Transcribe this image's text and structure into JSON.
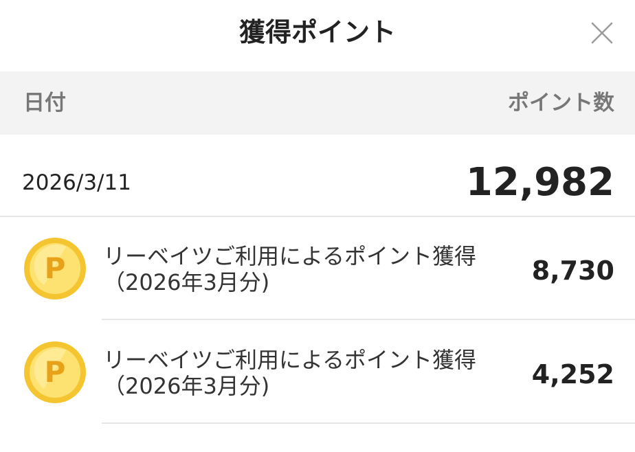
{
  "header": {
    "title": "獲得ポイント",
    "close_icon": "close-icon"
  },
  "columns": {
    "date": "日付",
    "points": "ポイント数"
  },
  "group": {
    "date": "2026/3/11",
    "total": "12,982"
  },
  "items": [
    {
      "icon": "point-coin-icon",
      "description": "リーベイツご利用によるポイント獲得（2026年3月分)",
      "points": "8,730"
    },
    {
      "icon": "point-coin-icon",
      "description": "リーベイツご利用によるポイント獲得（2026年3月分)",
      "points": "4,252"
    }
  ],
  "colors": {
    "coin_outer": "#f5c531",
    "coin_inner": "#fde272",
    "coin_letter": "#e8a21a",
    "header_band": "#f3f3f3"
  }
}
